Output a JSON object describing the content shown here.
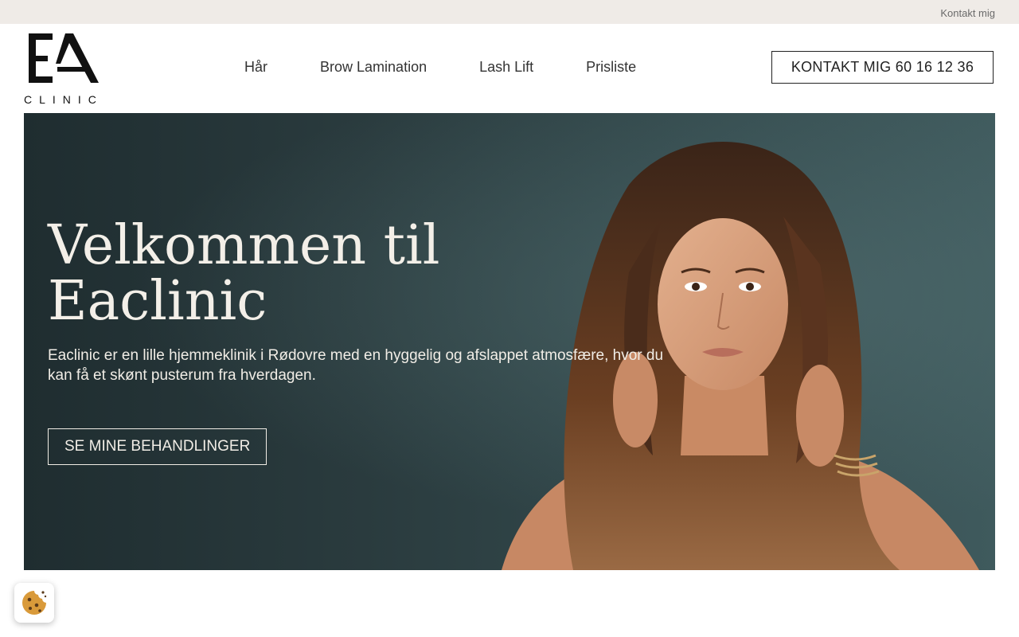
{
  "topbar": {
    "contact_link": "Kontakt mig"
  },
  "logo": {
    "monogram": "EA",
    "text": "CLINIC"
  },
  "nav": {
    "items": [
      {
        "label": "Hår"
      },
      {
        "label": "Brow Lamination"
      },
      {
        "label": "Lash Lift"
      },
      {
        "label": "Prisliste"
      }
    ]
  },
  "header": {
    "cta_label": "KONTAKT MIG 60 16 12 36"
  },
  "hero": {
    "title_line1": "Velkommen til",
    "title_line2": "Eaclinic",
    "description": "Eaclinic er en lille hjemmeklinik i Rødovre med en hyggelig og afslappet atmosfære, hvor du kan få et skønt pusterum fra hverdagen.",
    "cta_label": "SE MINE BEHANDLINGER"
  },
  "cookie": {
    "icon": "cookie-icon"
  },
  "colors": {
    "topbar_bg": "#efebe7",
    "hero_bg": "#2a3b3e",
    "hero_text": "#f3efe8",
    "cookie": "#d99a3a"
  }
}
